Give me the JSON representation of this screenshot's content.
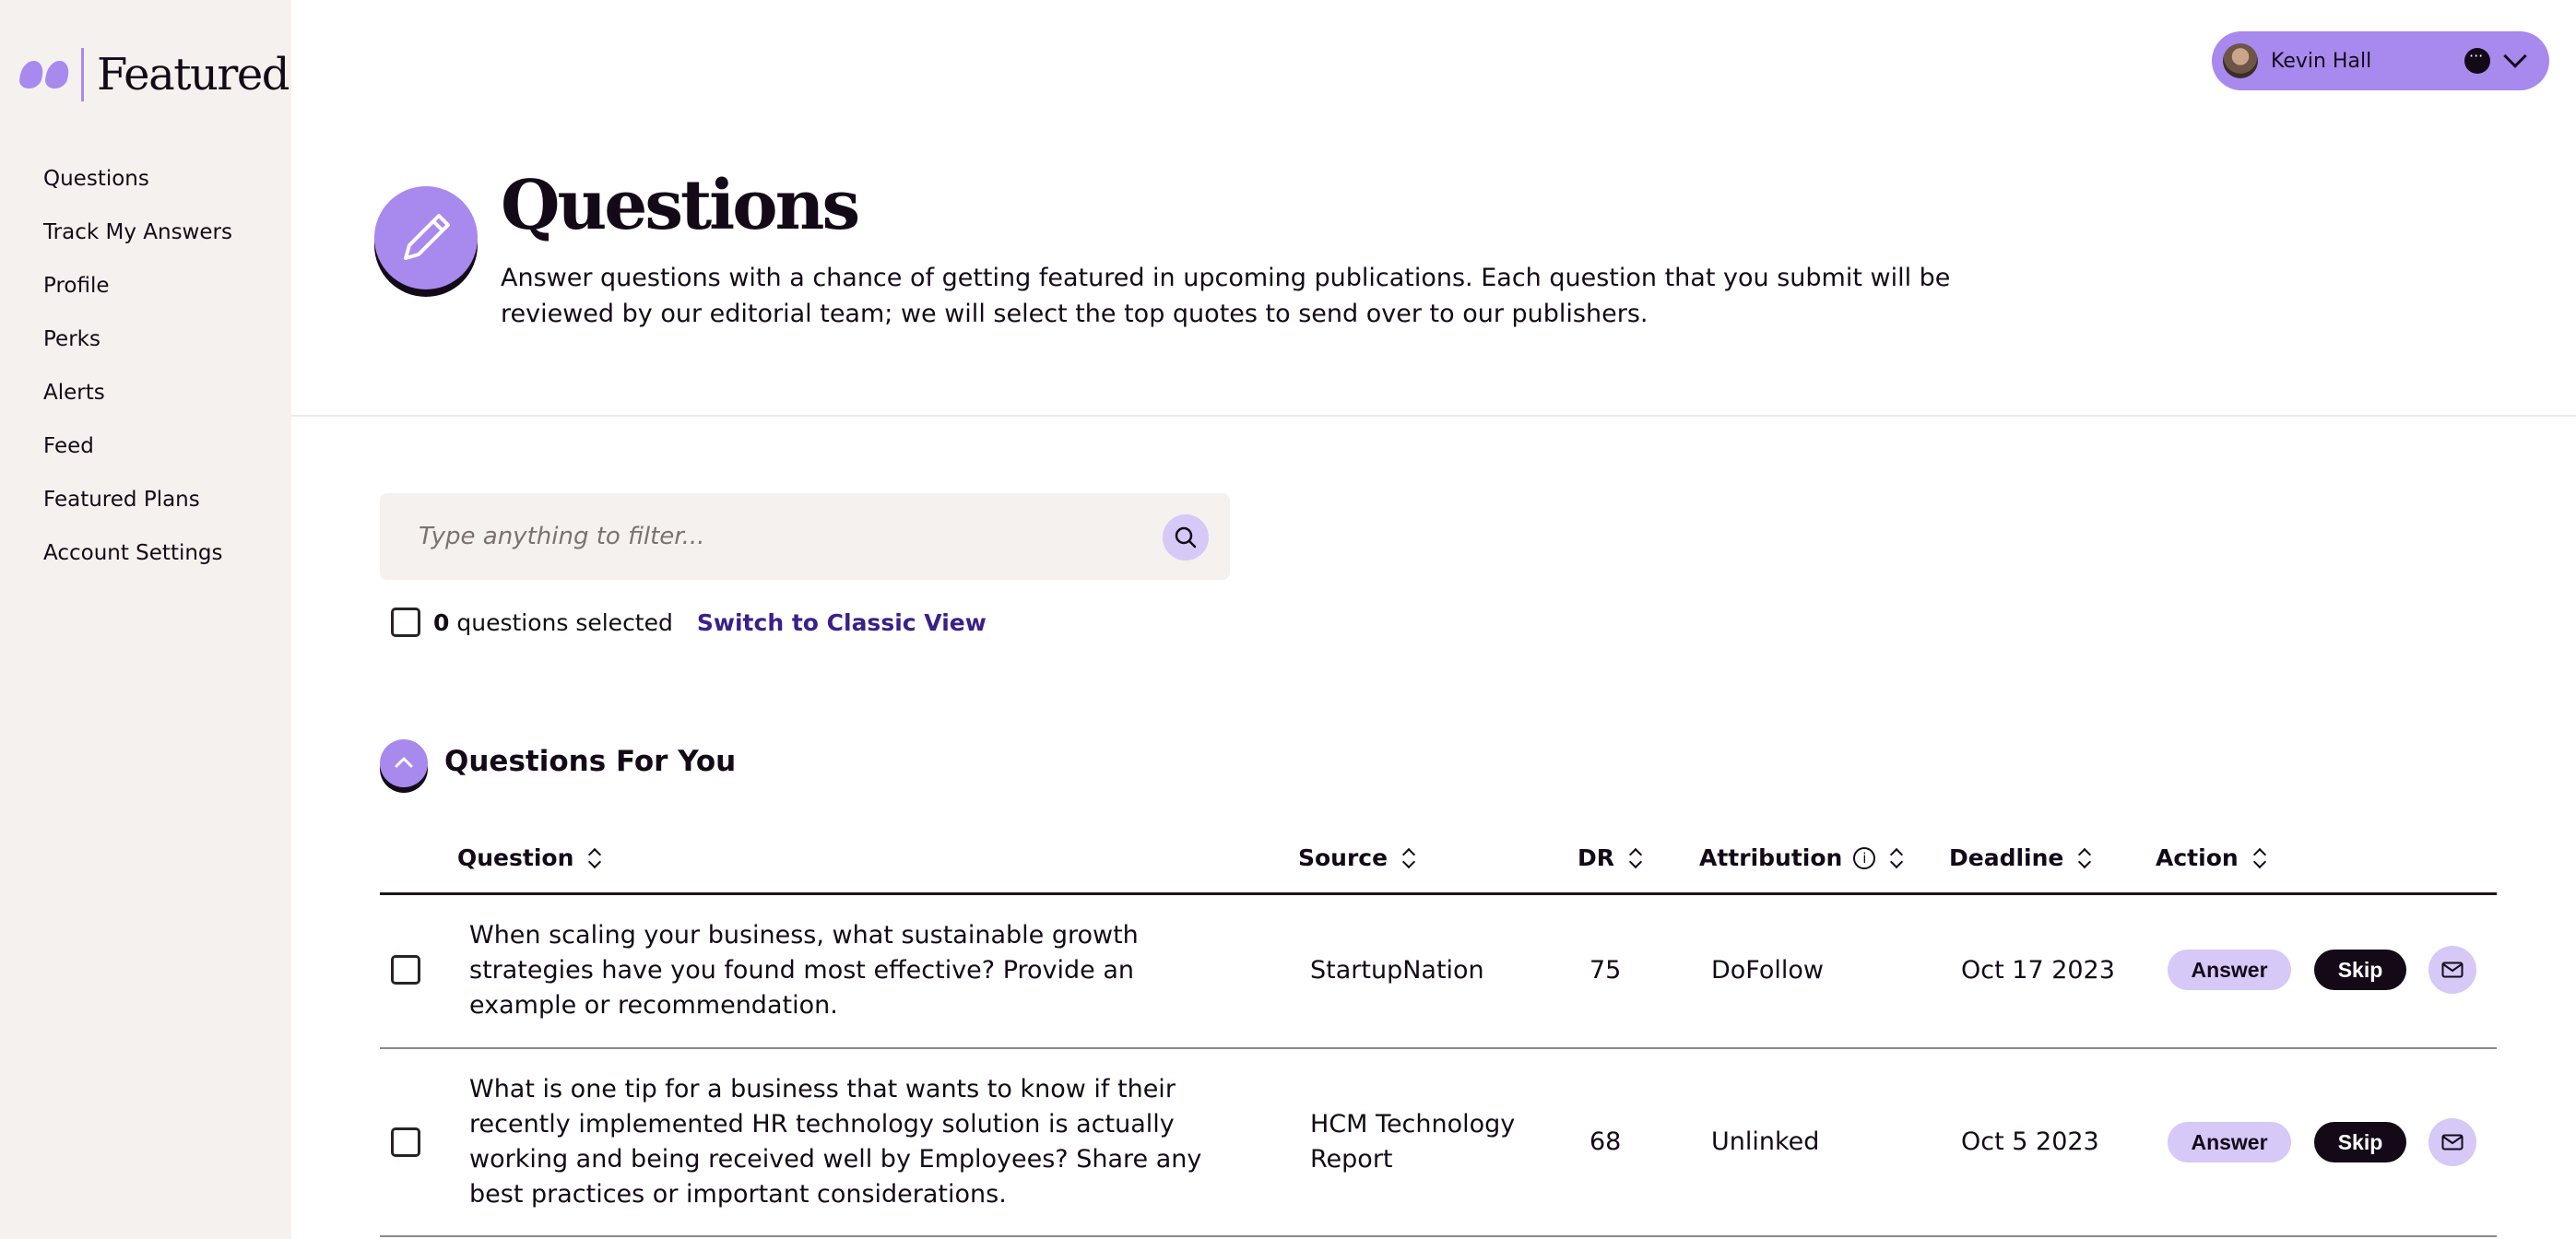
{
  "brand": {
    "name": "Featured",
    "accent": "#a889ee",
    "dark": "#140a17",
    "soft_accent": "#d6c8f7"
  },
  "sidebar": {
    "items": [
      {
        "label": "Questions"
      },
      {
        "label": "Track My Answers"
      },
      {
        "label": "Profile"
      },
      {
        "label": "Perks"
      },
      {
        "label": "Alerts"
      },
      {
        "label": "Feed"
      },
      {
        "label": "Featured Plans"
      },
      {
        "label": "Account Settings"
      }
    ]
  },
  "header": {
    "user_name": "Kevin Hall",
    "user_menu_icon": "chevron-down-icon",
    "message_icon": "chat-bubble-icon"
  },
  "page": {
    "icon": "pencil-icon",
    "title": "Questions",
    "description": "Answer questions with a chance of getting featured in upcoming publications. Each question that you submit will be reviewed by our editorial team; we will select the top quotes to send over to our publishers."
  },
  "filter": {
    "placeholder": "Type anything to filter...",
    "value": "",
    "icon": "search-icon"
  },
  "selection": {
    "count": "0",
    "suffix": " questions selected",
    "switch_label": "Switch to Classic View"
  },
  "section": {
    "title": "Questions For You",
    "toggle_icon": "chevron-up-icon"
  },
  "table": {
    "columns": [
      "Question",
      "Source",
      "DR",
      "Attribution",
      "Deadline",
      "Action"
    ],
    "rows": [
      {
        "question": "When scaling your business, what sustainable growth strategies have you found most effective? Provide an example or recommendation.",
        "source": "StartupNation",
        "dr": "75",
        "attribution": "DoFollow",
        "deadline": "Oct 17 2023",
        "answer_label": "Answer",
        "skip_label": "Skip"
      },
      {
        "question": "What is one tip for a business that wants to know if their recently implemented HR technology solution is actually working and being received well by Employees? Share any best practices or important considerations.",
        "source": "HCM Technology Report",
        "dr": "68",
        "attribution": "Unlinked",
        "deadline": "Oct 5 2023",
        "answer_label": "Answer",
        "skip_label": "Skip"
      }
    ]
  }
}
